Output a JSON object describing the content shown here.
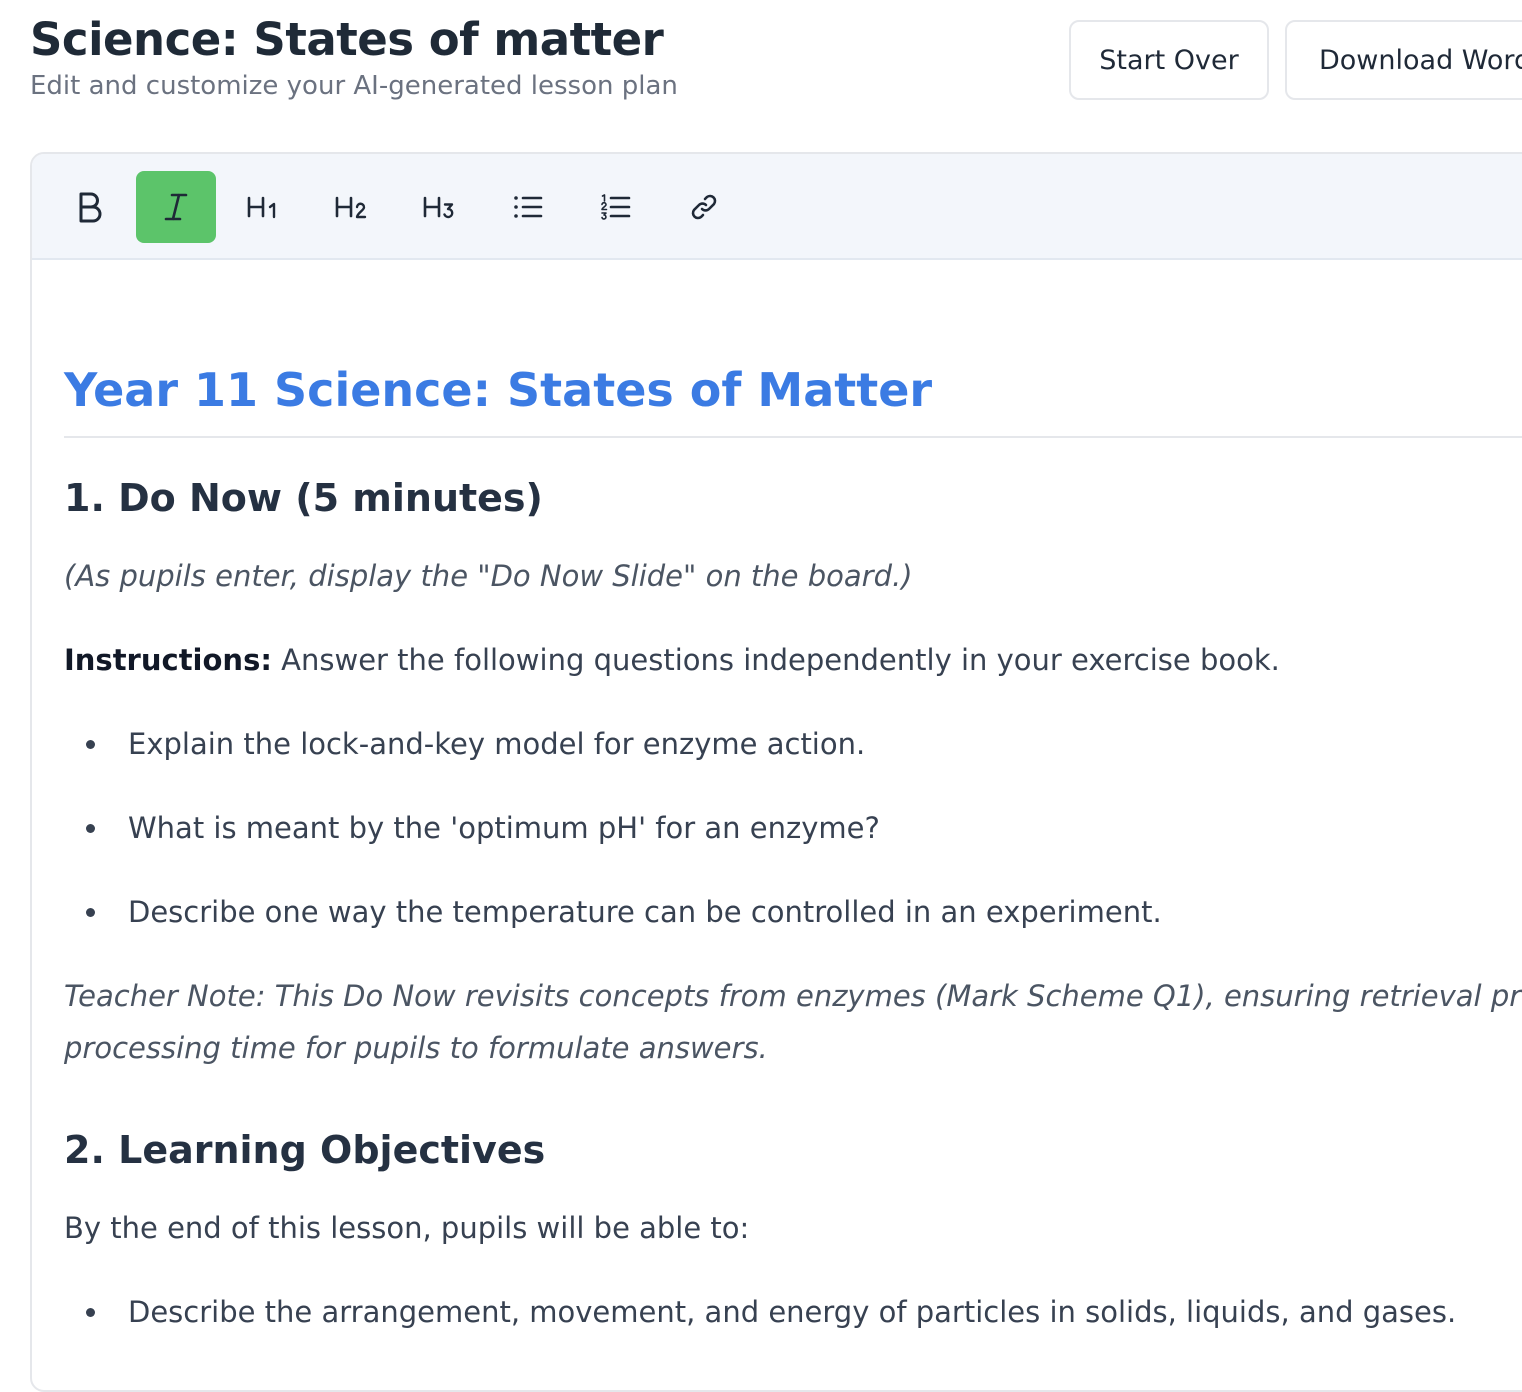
{
  "header": {
    "title": "Science: States of matter",
    "subtitle": "Edit and customize your AI-generated lesson plan",
    "start_over_label": "Start Over",
    "download_label": "Download Word"
  },
  "toolbar": {
    "items": [
      {
        "name": "bold",
        "label": "B",
        "active": false
      },
      {
        "name": "italic",
        "label": "I",
        "active": true
      },
      {
        "name": "heading-1",
        "label": "H1",
        "active": false
      },
      {
        "name": "heading-2",
        "label": "H2",
        "active": false
      },
      {
        "name": "heading-3",
        "label": "H3",
        "active": false
      },
      {
        "name": "bullet-list",
        "icon": "bullet-list-icon",
        "active": false
      },
      {
        "name": "ordered-list",
        "icon": "ordered-list-icon",
        "active": false
      },
      {
        "name": "link",
        "icon": "link-icon",
        "active": false
      }
    ],
    "active_color": "#5cc46a"
  },
  "document": {
    "title": "Year 11 Science: States of Matter",
    "title_color": "#3b7be3",
    "section1": {
      "heading": "1. Do Now (5 minutes)",
      "note": "(As pupils enter, display the \"Do Now Slide\" on the board.)",
      "instructions_label": "Instructions:",
      "instructions_text": " Answer the following questions independently in your exercise book.",
      "bullets": [
        "Explain the lock-and-key model for enzyme action.",
        "What is meant by the 'optimum pH' for an enzyme?",
        "Describe one way the temperature can be controlled in an experiment."
      ],
      "teacher_note_line1": "Teacher Note: This Do Now revisits concepts from enzymes (Mark Scheme Q1), ensuring retrieval practice",
      "teacher_note_line2": "processing time for pupils to formulate answers."
    },
    "section2": {
      "heading": "2. Learning Objectives",
      "intro": "By the end of this lesson, pupils will be able to:",
      "bullets": [
        "Describe the arrangement, movement, and energy of particles in solids, liquids, and gases."
      ]
    }
  }
}
